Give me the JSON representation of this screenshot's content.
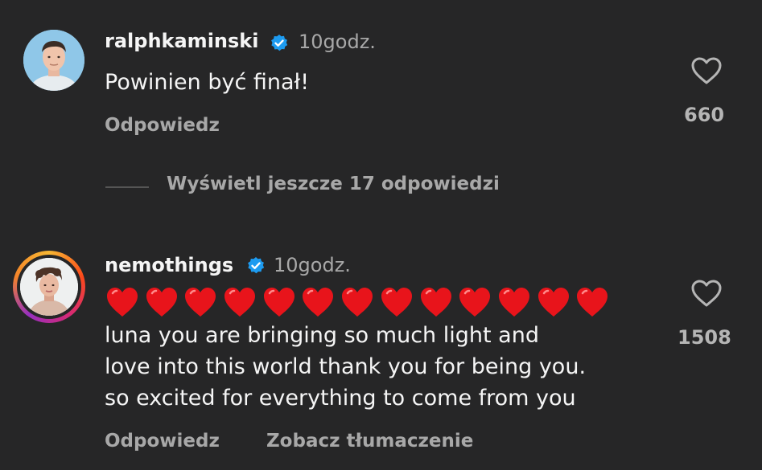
{
  "comments": [
    {
      "username": "ralphkaminski",
      "time": "10godz.",
      "text": "Powinien być finał!",
      "reply_label": "Odpowiedz",
      "likes": "660",
      "view_replies": "Wyświetl jeszcze 17 odpowiedzi"
    },
    {
      "username": "nemothings",
      "time": "10godz.",
      "emoji_line": "❤️❤️❤️❤️❤️❤️❤️❤️❤️❤️❤️❤️❤️",
      "heart_count": 13,
      "text_lines": [
        "luna you are bringing so much light and",
        "love into this world thank you for being you.",
        "so excited for everything to come from you"
      ],
      "reply_label": "Odpowiedz",
      "translate_label": "Zobacz tłumaczenie",
      "likes": "1508"
    }
  ],
  "colors": {
    "background": "#262627",
    "primary_text": "#f5f5f5",
    "secondary_text": "#a8a8a8",
    "verified_badge": "#1d9bf0",
    "heart_red": "#e8141b"
  },
  "icons": {
    "like": "heart-outline-icon",
    "verified": "verified-badge-icon"
  }
}
